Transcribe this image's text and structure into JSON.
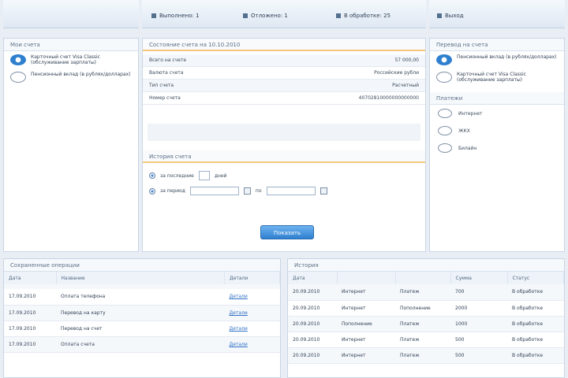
{
  "tabs": [
    {
      "label": "Выполнено: 1"
    },
    {
      "label": "Отложено: 1"
    },
    {
      "label": "В обработке: 25"
    },
    {
      "label": "Выход"
    }
  ],
  "left": {
    "title": "Мои счета",
    "products": [
      {
        "label": "Карточный счет Visa Classic (обслуживание зарплаты)",
        "icon": "bank-coin-icon"
      },
      {
        "label": "Пенсионный вклад (в рублях/долларах)",
        "icon": "coin-icon"
      }
    ]
  },
  "center": {
    "statement_title": "Состояние счета на 10.10.2010",
    "rows": [
      {
        "label": "Всего на счете",
        "value": "57 000,00"
      },
      {
        "label": "Валюта счета",
        "value": "Российские рубли"
      },
      {
        "label": "Тип счета",
        "value": "Расчетный"
      },
      {
        "label": "Номер счета",
        "value": "40702810000000000000"
      }
    ],
    "history_title": "История счета",
    "opt_days": "за последние",
    "opt_days_unit": "дней",
    "opt_period": "за период",
    "opt_to": "по",
    "button": "Показать"
  },
  "right": {
    "title": "Перевод на счета",
    "products": [
      {
        "label": "Пенсионный вклад (в рублях/долларах)",
        "icon": "bank-coin-icon"
      },
      {
        "label": "Карточный счет Visa Classic (обслуживание зарплаты)",
        "icon": "coin-icon"
      }
    ],
    "services_title": "Платежи",
    "services": [
      {
        "label": "Интернет"
      },
      {
        "label": "ЖКХ"
      },
      {
        "label": "Билайн"
      }
    ]
  },
  "saved": {
    "title": "Сохраненные операции",
    "headers": [
      "Дата",
      "Название",
      "Детали"
    ],
    "rows": [
      {
        "date": "17.09.2010",
        "name": "Оплата телефона",
        "link": "Детали"
      },
      {
        "date": "17.09.2010",
        "name": "Перевод на карту",
        "link": "Детали"
      },
      {
        "date": "17.09.2010",
        "name": "Перевод на счет",
        "link": "Детали"
      },
      {
        "date": "17.09.2010",
        "name": "Оплата счета",
        "link": "Детали"
      }
    ]
  },
  "history": {
    "title": "История",
    "headers": [
      "Дата",
      "",
      "",
      "Сумма",
      "Статус"
    ],
    "rows": [
      {
        "date": "20.09.2010",
        "a": "Интернет",
        "b": "Платеж",
        "sum": "700",
        "status": "В обработке"
      },
      {
        "date": "20.09.2010",
        "a": "Интернет",
        "b": "Пополнение",
        "sum": "2000",
        "status": "В обработке"
      },
      {
        "date": "20.09.2010",
        "a": "Пополнение",
        "b": "Платеж",
        "sum": "1000",
        "status": "В обработке"
      },
      {
        "date": "20.09.2010",
        "a": "Интернет",
        "b": "Платеж",
        "sum": "500",
        "status": "В обработке"
      },
      {
        "date": "20.09.2010",
        "a": "Интернет",
        "b": "Платеж",
        "sum": "500",
        "status": "В обработке"
      }
    ]
  }
}
